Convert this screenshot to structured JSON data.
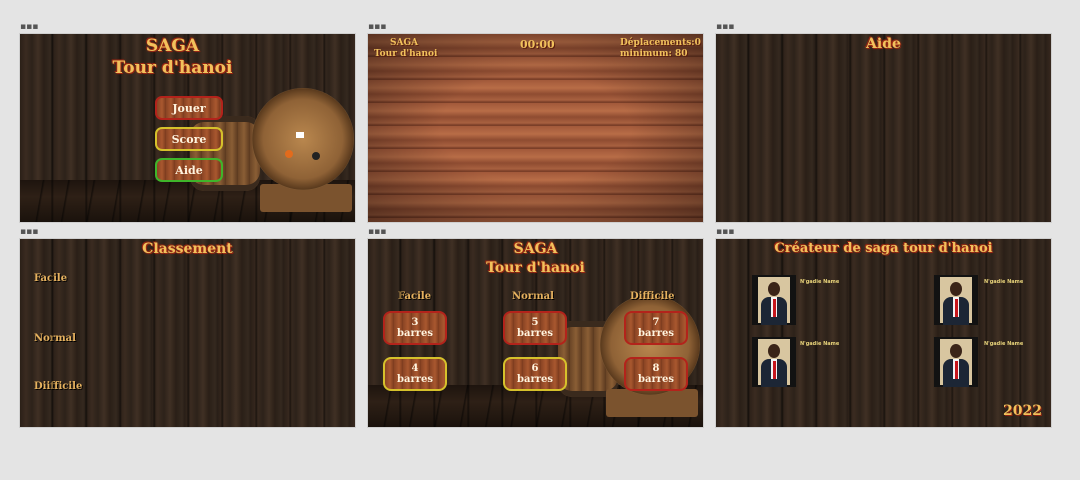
{
  "frames": [
    {
      "id": "menu",
      "title1": "SAGA",
      "title2": "Tour d'hanoi",
      "buttons": [
        "Jouer",
        "Score",
        "Aide"
      ]
    },
    {
      "id": "game",
      "saga": "SAGA",
      "tour": "Tour d'hanoi",
      "timer": "00:00",
      "moves": "Déplacements:0",
      "minimum": "minimum: 80"
    },
    {
      "id": "help",
      "title": "Aide"
    },
    {
      "id": "ranking",
      "title": "Classement",
      "levels": [
        "Facile",
        "Normal",
        "Diifficile"
      ]
    },
    {
      "id": "levels",
      "title1": "SAGA",
      "title2": "Tour d'hanoi",
      "difficulties": [
        "Facile",
        "Normal",
        "Difficile"
      ],
      "options": [
        {
          "num": "3",
          "unit": "barres"
        },
        {
          "num": "5",
          "unit": "barres"
        },
        {
          "num": "7",
          "unit": "barres"
        },
        {
          "num": "4",
          "unit": "barres"
        },
        {
          "num": "6",
          "unit": "barres"
        },
        {
          "num": "8",
          "unit": "barres"
        }
      ]
    },
    {
      "id": "credits",
      "title": "Créateur de saga tour d'hanoi",
      "name": "N'gadie Name",
      "year": "2022"
    }
  ],
  "frame_marker": "▪▪▪",
  "colors": {
    "title": "#f1c15c",
    "title_outline": "#8e2311",
    "btn_red": "#b3231b",
    "btn_yellow": "#d6c12b",
    "btn_green": "#3fb52a"
  }
}
